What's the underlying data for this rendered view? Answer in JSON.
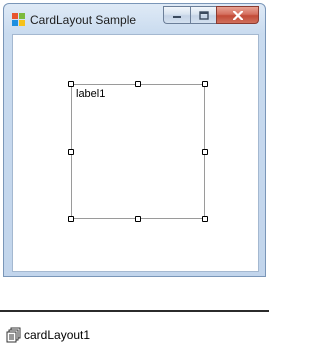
{
  "window": {
    "title": "CardLayout Sample",
    "icon": "windows-forms-app-icon",
    "caption_buttons": [
      "minimize",
      "maximize",
      "close"
    ]
  },
  "form": {
    "selected_control": {
      "label": "label1"
    }
  },
  "component_tray": {
    "items": [
      {
        "label": "cardLayout1",
        "icon": "component-icon"
      }
    ]
  },
  "colors": {
    "frame": "#c2d5ec",
    "close_button": "#c24a36",
    "client_background": "#ffffff"
  }
}
